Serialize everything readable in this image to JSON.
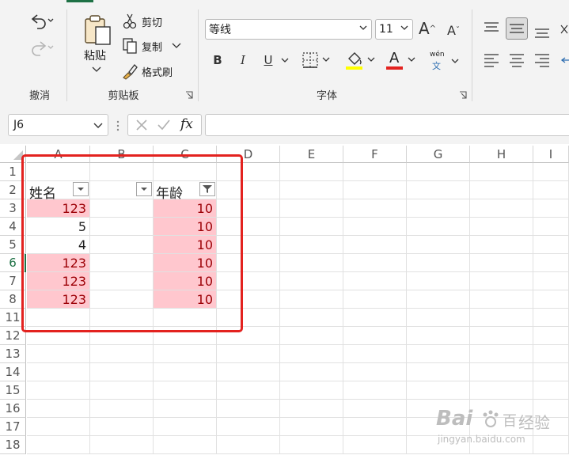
{
  "ribbon": {
    "undo_group_label": "撤消",
    "clipboard": {
      "paste_label": "粘贴",
      "cut_label": "剪切",
      "copy_label": "复制",
      "format_painter_label": "格式刷",
      "group_label": "剪贴板"
    },
    "font": {
      "font_name": "等线",
      "font_size": "11",
      "grow_label": "A",
      "shrink_label": "A",
      "bold_label": "B",
      "italic_label": "I",
      "underline_label": "U",
      "font_color_label": "A",
      "phonetic_top": "wén",
      "phonetic_bottom": "文",
      "group_label": "字体"
    }
  },
  "formula_bar": {
    "name_box": "J6",
    "fx_label": "fx",
    "formula_value": ""
  },
  "grid": {
    "columns": [
      "A",
      "B",
      "C",
      "D",
      "E",
      "F",
      "G",
      "H",
      "I"
    ],
    "rows": [
      "1",
      "2",
      "3",
      "4",
      "5",
      "6",
      "7",
      "8",
      "11",
      "12",
      "13",
      "14",
      "15",
      "16",
      "17",
      "18"
    ],
    "header_a": "姓名",
    "header_c": "年龄",
    "values_a": [
      "123",
      "5",
      "4",
      "123",
      "123",
      "123"
    ],
    "values_c": [
      "10",
      "10",
      "10",
      "10",
      "10",
      "10"
    ],
    "highlighted_rows": [
      true,
      false,
      false,
      true,
      true,
      true
    ],
    "selected_row": "6",
    "colors": {
      "highlight_fill": "#ffc7ce",
      "highlight_text": "#9c0006",
      "annotation_box": "#e3221f",
      "accent": "#1e7145"
    }
  },
  "watermark": {
    "brand": "Bai",
    "brand_tail": "百",
    "site_cn": "经验",
    "site_url": "jingyan.baidu.com"
  }
}
